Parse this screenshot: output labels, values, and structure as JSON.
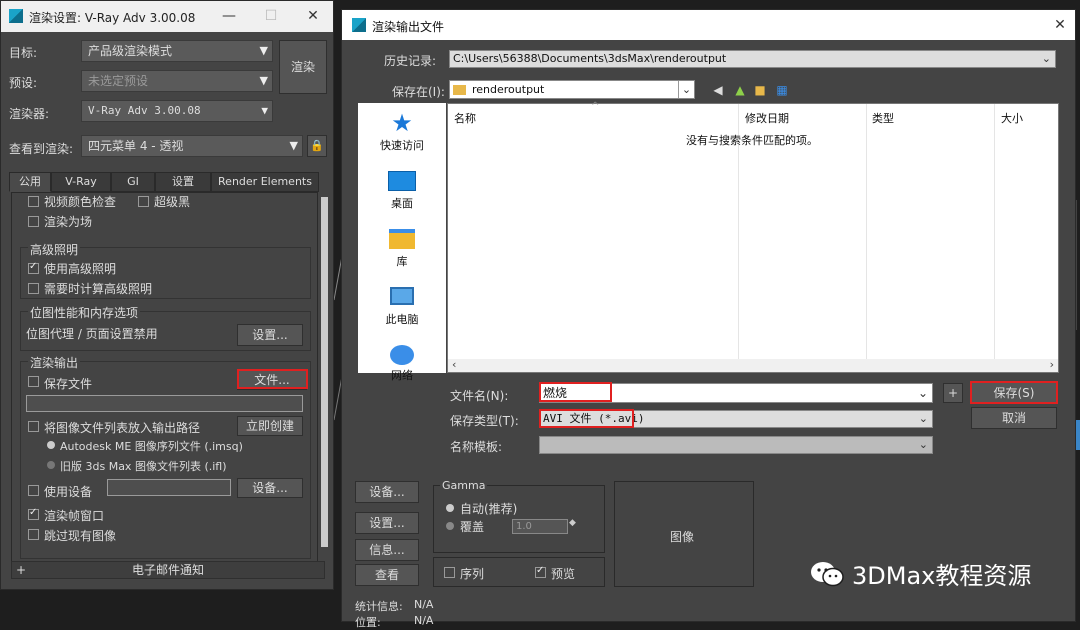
{
  "vray": {
    "title": "渲染设置: V-Ray Adv 3.00.08",
    "target_label": "目标:",
    "target_value": "产品级渲染模式",
    "preset_label": "预设:",
    "preset_value": "未选定预设",
    "renderer_label": "渲染器:",
    "renderer_value": "V-Ray Adv 3.00.08",
    "render_button": "渲染",
    "view_label": "查看到渲染:",
    "view_value": "四元菜单 4 - 透视",
    "tabs": [
      "公用",
      "V-Ray",
      "GI",
      "设置",
      "Render Elements"
    ],
    "partial_row": "视频颜色检查",
    "partial_row2": "超级黑",
    "render_to_fields": "渲染为场",
    "adv_lighting": {
      "title": "高级照明",
      "use": "使用高级照明",
      "compute": "需要时计算高级照明"
    },
    "bitmap": {
      "title": "位图性能和内存选项",
      "desc": "位图代理 / 页面设置禁用",
      "setup_button": "设置..."
    },
    "render_output": {
      "title": "渲染输出",
      "save_file": "保存文件",
      "files_button": "文件...",
      "put_list": "将图像文件列表放入输出路径",
      "create_now": "立即创建",
      "opt1": "Autodesk ME 图像序列文件 (.imsq)",
      "opt2": "旧版 3ds Max 图像文件列表 (.ifl)",
      "use_device": "使用设备",
      "device_button": "设备...",
      "frame_window": "渲染帧窗口",
      "skip_existing": "跳过现有图像"
    },
    "email_rollout": "电子邮件通知"
  },
  "save_dialog": {
    "title": "渲染输出文件",
    "history_label": "历史记录:",
    "history_value": "C:\\Users\\56388\\Documents\\3dsMax\\renderoutput",
    "savein_label": "保存在(I):",
    "savein_value": "renderoutput",
    "places": [
      "快速访问",
      "桌面",
      "库",
      "此电脑",
      "网络"
    ],
    "columns": [
      "名称",
      "修改日期",
      "类型",
      "大小"
    ],
    "empty_msg": "没有与搜索条件匹配的项。",
    "filename_label": "文件名(N):",
    "filename_value": "燃烧",
    "filetype_label": "保存类型(T):",
    "filetype_value": "AVI 文件 (*.avi)",
    "template_label": "名称模板:",
    "plus_button": "+",
    "save_button": "保存(S)",
    "cancel_button": "取消",
    "setup_button": "设备...",
    "setup2_button": "设置...",
    "info_button": "信息...",
    "view_button": "查看",
    "gamma_title": "Gamma",
    "gamma_auto": "自动(推荐)",
    "gamma_override": "覆盖",
    "gamma_value": "1.0",
    "sequence": "序列",
    "preview": "预览",
    "image_label": "图像",
    "stats_label": "统计信息:",
    "stats_value": "N/A",
    "location_label": "位置:",
    "location_value": "N/A"
  },
  "watermark": "3DMax教程资源",
  "colors": {
    "accent_red": "#e02020",
    "panel_bg": "#444444",
    "window_bg": "#1e1e1e"
  }
}
